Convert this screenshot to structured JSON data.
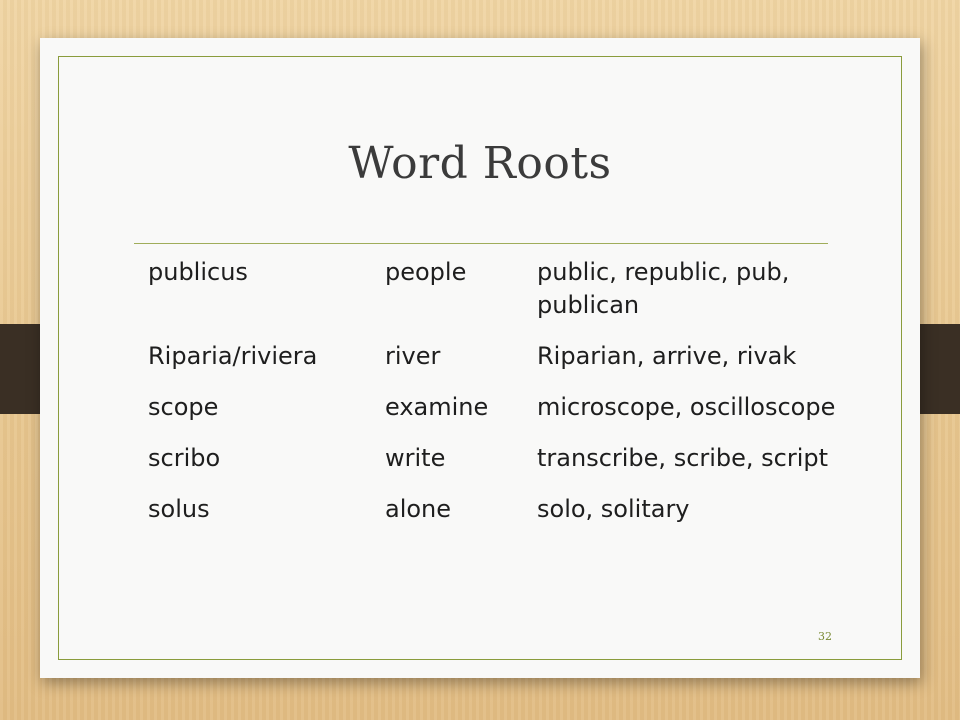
{
  "slide": {
    "title": "Word Roots",
    "page_number": "32",
    "rows": [
      {
        "root": "publicus",
        "meaning": "people",
        "examples": "public, republic, pub, publican"
      },
      {
        "root": "Riparia/riviera",
        "meaning": "river",
        "examples": "Riparian, arrive, rivak"
      },
      {
        "root": "scope",
        "meaning": "examine",
        "examples": "microscope, oscilloscope"
      },
      {
        "root": "scribo",
        "meaning": "write",
        "examples": "transcribe, scribe, script"
      },
      {
        "root": "solus",
        "meaning": "alone",
        "examples": "solo, solitary"
      }
    ]
  }
}
